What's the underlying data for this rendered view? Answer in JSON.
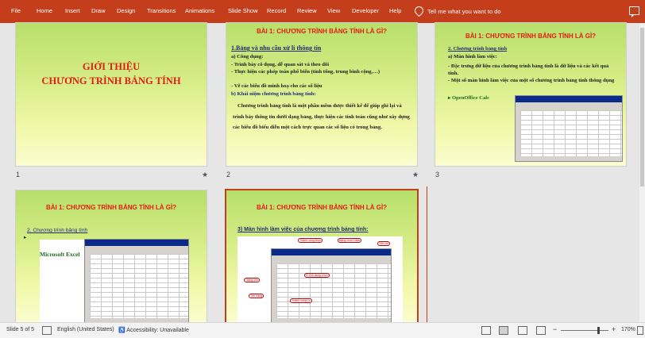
{
  "menu": {
    "items": [
      "File",
      "Home",
      "Insert",
      "Draw",
      "Design",
      "Transitions",
      "Animations",
      "Slide Show",
      "Record",
      "Review",
      "View",
      "Developer",
      "Help"
    ],
    "tell_me": "Tell me what you want to do",
    "color": "#c43e1c"
  },
  "slides": [
    {
      "number": "1",
      "star": "★",
      "title_line1": "GIỚI THIỆU",
      "title_line2": "CHƯƠNG TRÌNH BẢNG TÍNH"
    },
    {
      "number": "2",
      "star": "★",
      "title": "BÀI 1: CHƯƠNG TRÌNH BẢNG TÍNH LÀ GÌ?",
      "heading": "1.Bảng và nhu cầu xử lí thông tin",
      "sub_a": "a)    Công dụng:",
      "line1": "- Trình bày cô đọng, dễ quan sát và theo dõi",
      "line2": "- Thực hiện các phép toán phổ biến (tính tổng, trung bình cộng,…)",
      "line3": "- Vẽ các biểu đồ minh hoạ cho các số liệu",
      "sub_b": "b) Khái niệm chương trình bảng tính:",
      "paragraph": "Chương trình bảng tính là một phần mềm được thiết kế để giúp ghi lại và trình bày thông tin dưới dạng bảng, thực hiện các tính toán cũng như xây dựng các biểu đồ biểu diễn một cách trực quan các số liệu có trong bảng."
    },
    {
      "number": "3",
      "title": "BÀI 1: CHƯƠNG TRÌNH BẢNG TÍNH LÀ GÌ?",
      "heading": "2. Chương trình bảng tính",
      "sub_a": "a)    Màn hình làm việc:",
      "line1": "- Đặc trưng dữ liệu của chương trình bảng tính là dữ liệu và các kết quả tính.",
      "line2": "-     Một số màn hình làm việc của một số chương trình bảng tính thông dụng",
      "bullet": "OpenOffice Calc"
    },
    {
      "title": "BÀI 1: CHƯƠNG TRÌNH BẢNG TÍNH LÀ GÌ?",
      "heading": "2. Chương trình bảng tính",
      "label": "Microsoft Excel"
    },
    {
      "title": "BÀI 1: CHƯƠNG TRÌNH BẢNG TÍNH LÀ GÌ?",
      "heading": "3) Màn hình làm việc của chương trình bảng tính:",
      "callouts": [
        "Thanh công thức",
        "Bảng chọn Data",
        "Trang tính",
        "Ô tính đang chọn",
        "Tên cột",
        "Tên hàng",
        "Thanh công cụ"
      ]
    }
  ],
  "status": {
    "slide": "Slide 5 of 5",
    "language": "English (United States)",
    "accessibility": "Accessibility: Unavailable",
    "zoom": "170%",
    "zoom_minus": "−",
    "zoom_plus": "+"
  }
}
